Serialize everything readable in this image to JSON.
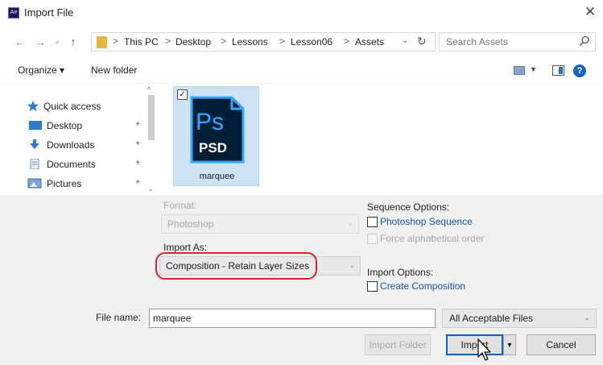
{
  "window": {
    "title": "Import File",
    "app_icon_text": "Ae",
    "close_glyph": "✕"
  },
  "address": {
    "back_glyph": "←",
    "forward_glyph": "→",
    "recent_glyph": "⌄",
    "up_glyph": "↑",
    "breadcrumbs": [
      "This PC",
      "Desktop",
      "Lessons",
      "Lesson06",
      "Assets"
    ],
    "separator": ">",
    "search_placeholder": "Search Assets"
  },
  "toolbar": {
    "organize_label": "Organize ▾",
    "new_folder_label": "New folder",
    "help_glyph": "?"
  },
  "nav": {
    "items": [
      {
        "label": "Quick access",
        "icon": "star-icon"
      },
      {
        "label": "Desktop",
        "icon": "desktop-icon"
      },
      {
        "label": "Downloads",
        "icon": "download-icon"
      },
      {
        "label": "Documents",
        "icon": "document-icon"
      },
      {
        "label": "Pictures",
        "icon": "pictures-icon"
      }
    ],
    "pin_glyph": "✦"
  },
  "files": [
    {
      "name": "marquee",
      "icon_text_top": "Ps",
      "icon_text_bottom": "PSD",
      "selected": true,
      "check_glyph": "✓"
    }
  ],
  "options": {
    "format_label": "Format:",
    "format_value": "Photoshop",
    "import_as_label": "Import As:",
    "import_as_value": "Composition - Retain Layer Sizes",
    "sequence_options_label": "Sequence Options:",
    "photoshop_sequence_label": "Photoshop Sequence",
    "force_alpha_label": "Force alphabetical order",
    "import_options_label": "Import Options:",
    "create_composition_label": "Create Composition"
  },
  "bottom": {
    "file_name_label": "File name:",
    "file_name_value": "marquee",
    "filter_value": "All Acceptable Files",
    "import_folder_label": "Import Folder",
    "import_label": "Import",
    "cancel_label": "Cancel"
  },
  "colors": {
    "accent": "#0a64c6",
    "highlight_ring": "#d8262c",
    "selection": "#cce2f5",
    "ps_icon_bg": "#001e36",
    "ps_icon_fg": "#31a8ff"
  }
}
